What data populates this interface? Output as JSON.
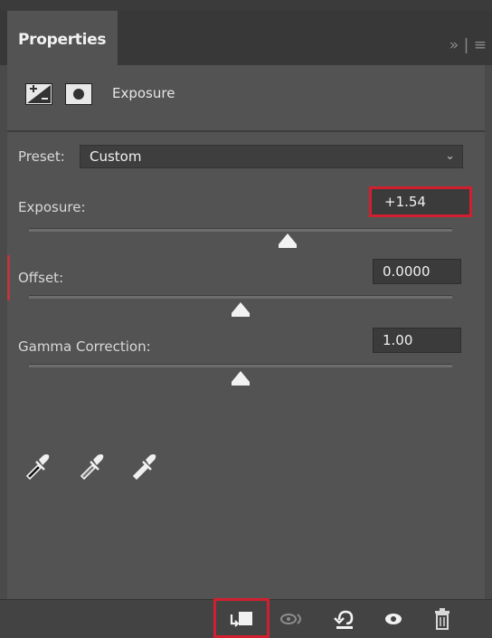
{
  "panel": {
    "tab_title": "Properties",
    "adjustment_title": "Exposure"
  },
  "preset": {
    "label": "Preset:",
    "value": "Custom"
  },
  "controls": [
    {
      "label": "Exposure:",
      "value": "+1.54",
      "slider_level": 0.62
    },
    {
      "label": "Offset:",
      "value": "0.0000",
      "slider_level": 0.5
    },
    {
      "label": "Gamma Correction:",
      "value": "1.00",
      "slider_level": 0.5
    }
  ],
  "icons": {
    "tab_controls": "collapse-icon",
    "eyedroppers": [
      "black-point-eyedropper-icon",
      "gray-point-eyedropper-icon",
      "white-point-eyedropper-icon"
    ],
    "bottom_bar": [
      "clip-to-layer-icon",
      "view-previous-state-icon",
      "reset-icon",
      "toggle-visibility-icon",
      "delete-icon"
    ]
  },
  "colors": {
    "highlight": "#d21f2f",
    "panel": "#535353"
  }
}
